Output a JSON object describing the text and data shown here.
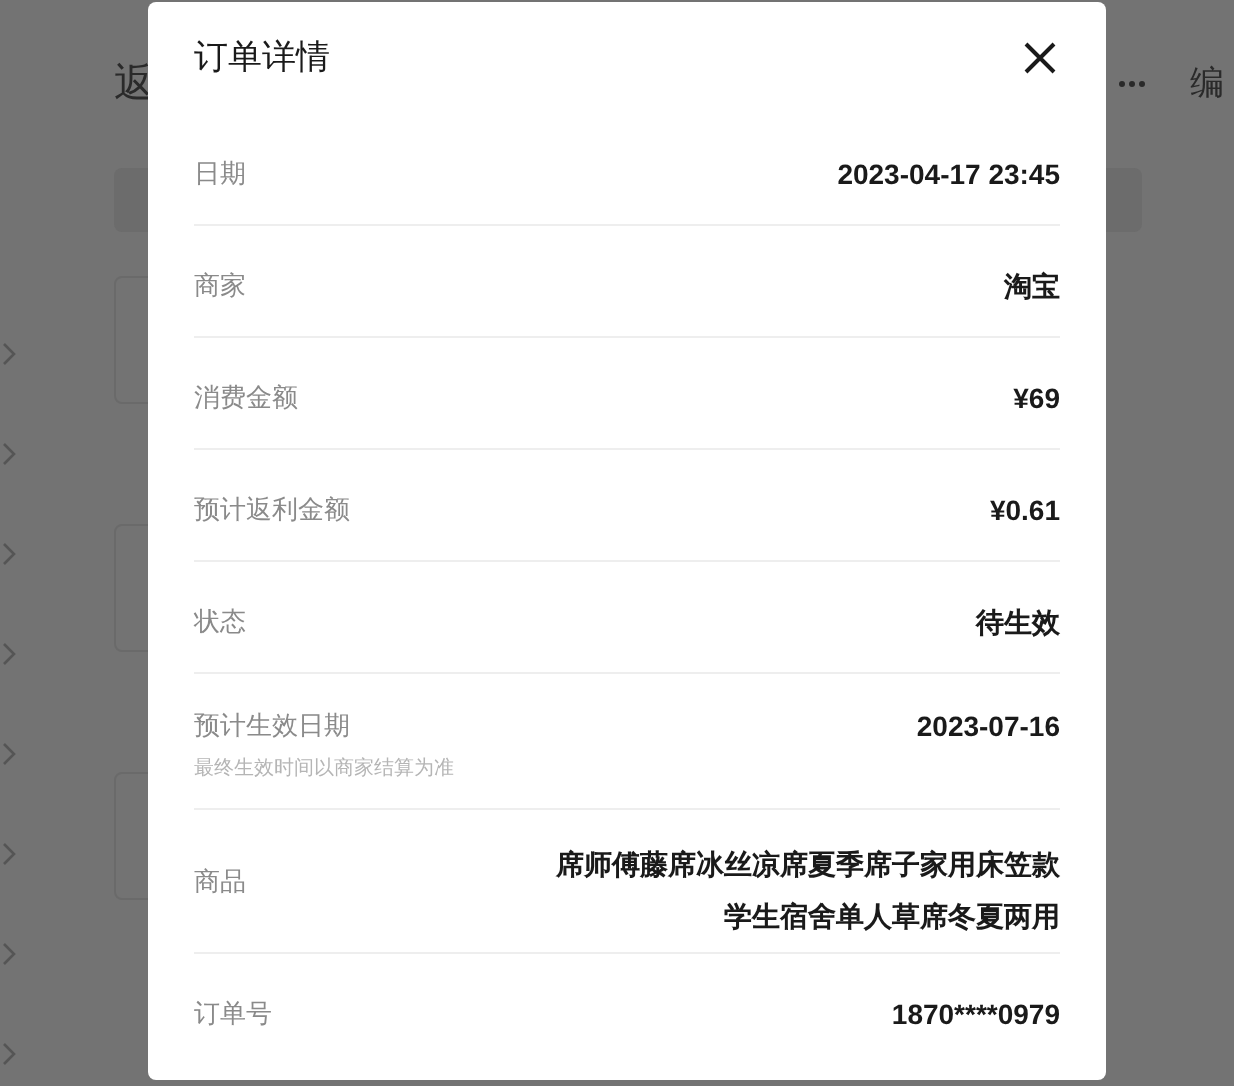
{
  "page": {
    "title": "返",
    "edit_link": "编"
  },
  "dialog": {
    "title": "订单详情",
    "rows": [
      {
        "label": "日期",
        "value": "2023-04-17 23:45"
      },
      {
        "label": "商家",
        "value": "淘宝"
      },
      {
        "label": "消费金额",
        "value": "¥69"
      },
      {
        "label": "预计返利金额",
        "value": "¥0.61"
      },
      {
        "label": "状态",
        "value": "待生效"
      },
      {
        "label": "预计生效日期",
        "note": "最终生效时间以商家结算为准",
        "value": "2023-07-16"
      },
      {
        "label": "商品",
        "value": "席师傅藤席冰丝凉席夏季席子家用床笠款学生宿舍单人草席冬夏两用"
      },
      {
        "label": "订单号",
        "value": "1870****0979"
      }
    ]
  }
}
